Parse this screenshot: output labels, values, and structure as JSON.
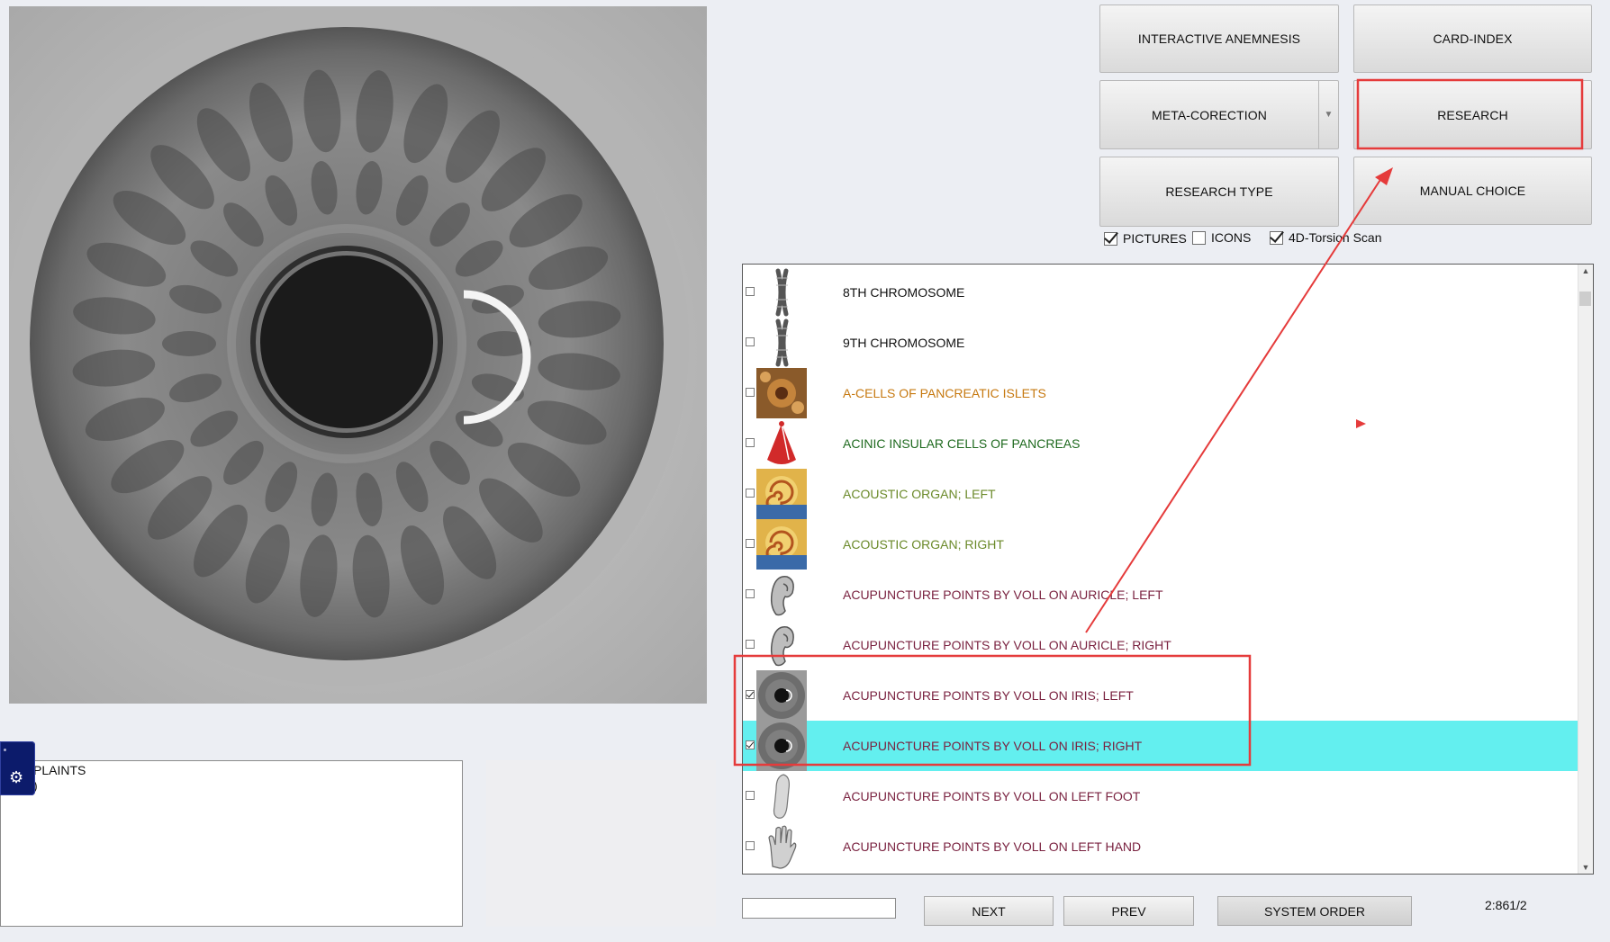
{
  "toolbar": {
    "interactive_anemnesis": "INTERACTIVE ANEMNESIS",
    "card_index": "CARD-INDEX",
    "meta_correction": "META-CORECTION",
    "research": "RESEARCH",
    "research_type": "RESEARCH TYPE",
    "manual_choice": "MANUAL CHOICE"
  },
  "options": {
    "pictures": {
      "label": "PICTURES",
      "checked": true
    },
    "icons": {
      "label": "ICONS",
      "checked": false
    },
    "torsion": {
      "label": "4D-Torsion Scan",
      "checked": true
    }
  },
  "list": {
    "items": [
      {
        "label": "8TH CHROMOSOME",
        "color": "#111111",
        "checked": false,
        "selected": false,
        "thumb": "chromosome-icon"
      },
      {
        "label": "9TH CHROMOSOME",
        "color": "#111111",
        "checked": false,
        "selected": false,
        "thumb": "chromosome-icon"
      },
      {
        "label": "A-CELLS OF PANCREATIC ISLETS",
        "color": "#c6780f",
        "checked": false,
        "selected": false,
        "thumb": "pancreatic-cells-icon"
      },
      {
        "label": "ACINIC INSULAR CELLS OF PANCREAS",
        "color": "#1f6a1f",
        "checked": false,
        "selected": false,
        "thumb": "acinus-icon"
      },
      {
        "label": "ACOUSTIC ORGAN; LEFT",
        "color": "#6b8a2a",
        "checked": false,
        "selected": false,
        "thumb": "cochlea-icon"
      },
      {
        "label": "ACOUSTIC ORGAN; RIGHT",
        "color": "#6b8a2a",
        "checked": false,
        "selected": false,
        "thumb": "cochlea-icon"
      },
      {
        "label": "ACUPUNCTURE POINTS BY VOLL ON AURICLE; LEFT",
        "color": "#7a2240",
        "checked": false,
        "selected": false,
        "thumb": "ear-icon"
      },
      {
        "label": "ACUPUNCTURE POINTS BY VOLL ON AURICLE; RIGHT",
        "color": "#7a2240",
        "checked": false,
        "selected": false,
        "thumb": "ear-icon"
      },
      {
        "label": "ACUPUNCTURE POINTS BY VOLL ON IRIS; LEFT",
        "color": "#7a2240",
        "checked": true,
        "selected": false,
        "thumb": "iris-icon"
      },
      {
        "label": "ACUPUNCTURE POINTS BY VOLL ON IRIS; RIGHT",
        "color": "#7a2240",
        "checked": true,
        "selected": true,
        "thumb": "iris-icon"
      },
      {
        "label": "ACUPUNCTURE POINTS BY VOLL ON LEFT FOOT",
        "color": "#7a2240",
        "checked": false,
        "selected": false,
        "thumb": "foot-icon"
      },
      {
        "label": "ACUPUNCTURE POINTS BY VOLL ON LEFT HAND",
        "color": "#7a2240",
        "checked": false,
        "selected": false,
        "thumb": "hand-icon"
      }
    ]
  },
  "bottom": {
    "next": "NEXT",
    "prev": "PREV",
    "system_order": "SYSTEM ORDER",
    "counter": "2:861/2",
    "search_value": ""
  },
  "complaints": {
    "line1": "PLAINTS",
    "line2": ")"
  },
  "colors": {
    "highlight_row": "#63efef",
    "annotation_red": "#e53b3b"
  }
}
